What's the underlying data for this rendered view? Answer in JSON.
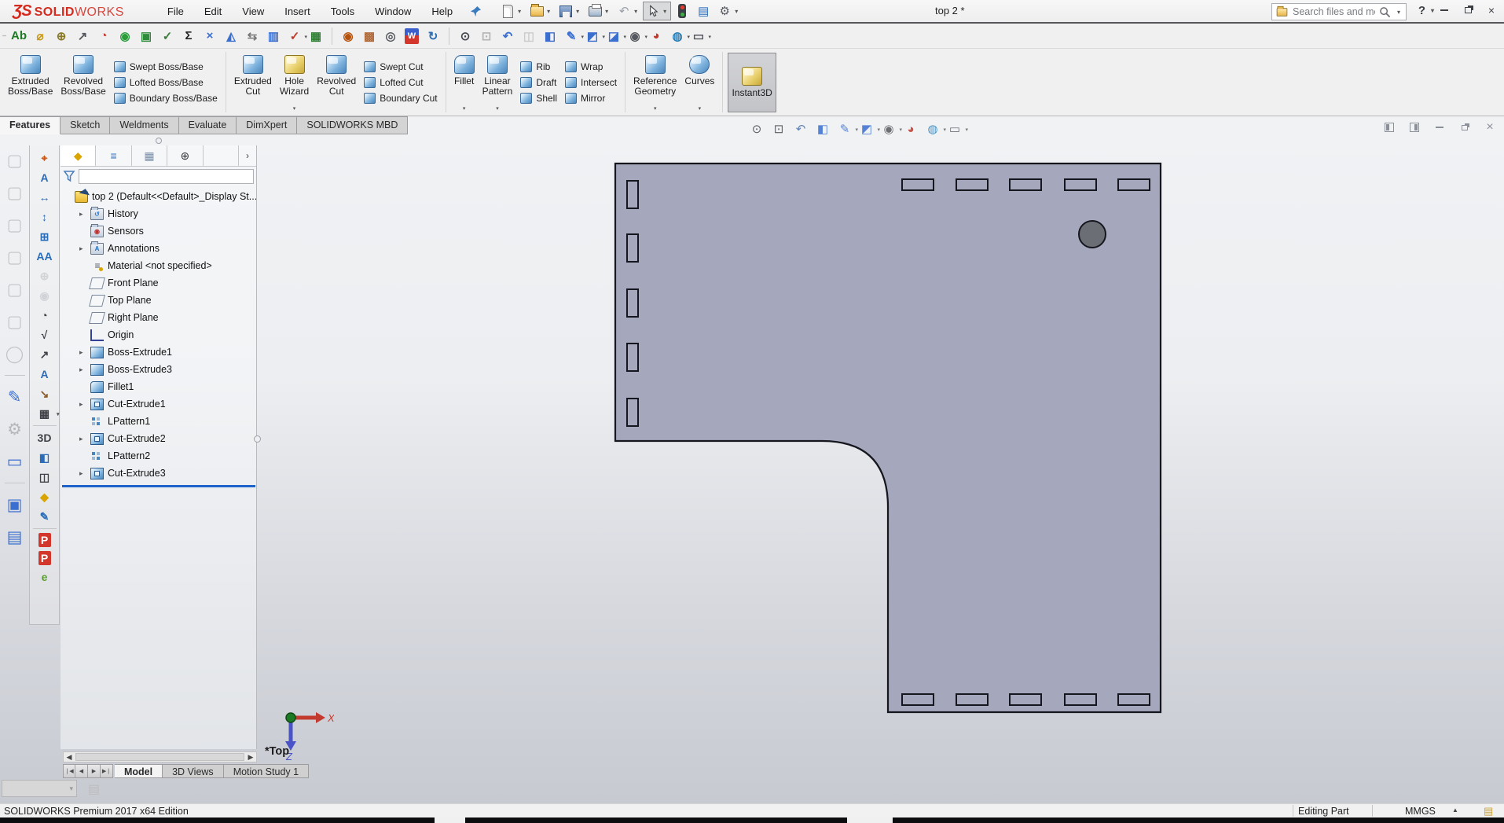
{
  "colors": {
    "brand_red": "#d42b1e",
    "part_fill": "#a5a8bc",
    "part_edge": "#16161e",
    "hole_fill": "#6c6e76",
    "rollback_blue": "#1f62c9"
  },
  "titlebar": {
    "logo_ds": "ƷS",
    "logo_solid": "SOLID",
    "logo_works": "WORKS",
    "doc_title": "top 2 *",
    "search_placeholder": "Search files and models",
    "help_label": "?",
    "menus": [
      {
        "label": "File",
        "name": "menu-file"
      },
      {
        "label": "Edit",
        "name": "menu-edit"
      },
      {
        "label": "View",
        "name": "menu-view"
      },
      {
        "label": "Insert",
        "name": "menu-insert"
      },
      {
        "label": "Tools",
        "name": "menu-tools"
      },
      {
        "label": "Window",
        "name": "menu-window"
      },
      {
        "label": "Help",
        "name": "menu-help"
      }
    ],
    "quick_tools": [
      {
        "name": "new-document-button",
        "cls": "i-doc",
        "dropdown": true
      },
      {
        "name": "open-document-button",
        "cls": "i-folder",
        "dropdown": true
      },
      {
        "name": "save-button",
        "cls": "i-save",
        "dropdown": true
      },
      {
        "name": "print-button",
        "cls": "i-print",
        "dropdown": true
      },
      {
        "name": "undo-button",
        "glyph": "↶",
        "color": "#9aa0a8",
        "dropdown": true,
        "disabled": true
      },
      {
        "name": "select-tool-button",
        "cls": "cursor",
        "dropdown": true,
        "active": true
      },
      {
        "name": "interference-check-button",
        "cls": "i-lights"
      },
      {
        "name": "options-list-button",
        "glyph": "▤",
        "color": "#2b6cb8"
      },
      {
        "name": "options-gear-button",
        "glyph": "⚙",
        "color": "#55585e",
        "dropdown": true
      }
    ]
  },
  "toolbar2": {
    "items": [
      {
        "name": "spell-checker-icon",
        "glyph": "Ab",
        "color": "#1d7a24"
      },
      {
        "name": "measure-icon",
        "glyph": "⌀",
        "color": "#c89a1a"
      },
      {
        "name": "mass-properties-icon",
        "glyph": "⊕",
        "color": "#8a7a2a"
      },
      {
        "name": "statistics-icon",
        "glyph": "↗",
        "color": "#55585e"
      },
      {
        "name": "performance-evaluation-icon",
        "glyph": "◔",
        "color": "#c0392b"
      },
      {
        "name": "assembly-visualization-icon",
        "glyph": "◉",
        "color": "#2a9d3a"
      },
      {
        "name": "check-active-document-icon",
        "glyph": "▣",
        "color": "#2e8b3a"
      },
      {
        "name": "design-checker-icon",
        "glyph": "✓",
        "color": "#3a7d3a"
      },
      {
        "name": "equations-icon",
        "glyph": "Σ",
        "color": "#222"
      },
      {
        "name": "deviation-analysis-icon",
        "glyph": "×",
        "color": "#3a6fd0"
      },
      {
        "name": "draft-analysis-icon",
        "glyph": "◭",
        "color": "#3a6fd0"
      },
      {
        "name": "symmetry-check-icon",
        "glyph": "⇆",
        "color": "#777"
      },
      {
        "name": "import-diagnostics-icon",
        "glyph": "▥",
        "color": "#3a6fd0"
      },
      {
        "name": "parting-line-analysis-icon",
        "glyph": "✓",
        "color": "#c0392b",
        "dropdown": true
      },
      {
        "name": "design-table-icon",
        "glyph": "▦",
        "color": "#2e7d32"
      },
      {
        "sep": true,
        "interactable": "false"
      },
      {
        "name": "appearance-filter-icon",
        "glyph": "◉",
        "color": "#b5520e"
      },
      {
        "name": "appearances-icon",
        "glyph": "▩",
        "color": "#b06a3a"
      },
      {
        "name": "verification-icon",
        "glyph": "◎",
        "color": "#55585e"
      },
      {
        "name": "design-binder-icon",
        "glyph": "W",
        "cls": "w-doc",
        "color": "#fff"
      },
      {
        "name": "reload-icon",
        "glyph": "↻",
        "color": "#2a6db5"
      },
      {
        "sep": true,
        "interactable": "false"
      },
      {
        "name": "zoom-to-fit-icon",
        "glyph": "⊙",
        "color": "#44474d"
      },
      {
        "name": "zoom-to-area-icon",
        "glyph": "⊡",
        "color": "#44474d",
        "disabled": true
      },
      {
        "name": "previous-view-icon",
        "glyph": "↶",
        "color": "#3a6fd0"
      },
      {
        "name": "pan-icon",
        "glyph": "◫",
        "color": "#888",
        "disabled": true
      },
      {
        "name": "section-view-icon",
        "glyph": "◧",
        "color": "#3a6fd0"
      },
      {
        "name": "3d-drawing-view-icon",
        "glyph": "✎",
        "color": "#3a6fd0",
        "dropdown": true
      },
      {
        "name": "view-orientation-icon",
        "glyph": "◩",
        "color": "#3a6fd0",
        "dropdown": true
      },
      {
        "name": "display-style-icon",
        "glyph": "◪",
        "color": "#3a6fd0",
        "dropdown": true
      },
      {
        "name": "hide-show-items-icon",
        "glyph": "◉",
        "color": "#55585e",
        "dropdown": true
      },
      {
        "name": "edit-appearance-icon",
        "glyph": "◕",
        "color": "#c0392b"
      },
      {
        "name": "apply-scene-icon",
        "glyph": "◍",
        "color": "#2980b9",
        "dropdown": true
      },
      {
        "name": "view-settings-icon",
        "glyph": "▭",
        "color": "#55585e",
        "dropdown": true
      }
    ]
  },
  "ribbon": {
    "extruded_boss": [
      "Extruded",
      "Boss/Base"
    ],
    "revolved_boss": [
      "Revolved",
      "Boss/Base"
    ],
    "swept_boss": "Swept Boss/Base",
    "lofted_boss": "Lofted Boss/Base",
    "boundary_boss": "Boundary Boss/Base",
    "extruded_cut": [
      "Extruded",
      "Cut"
    ],
    "hole_wizard": [
      "Hole",
      "Wizard"
    ],
    "revolved_cut": [
      "Revolved",
      "Cut"
    ],
    "swept_cut": "Swept Cut",
    "lofted_cut": "Lofted Cut",
    "boundary_cut": "Boundary Cut",
    "fillet": "Fillet",
    "linear_pattern": [
      "Linear",
      "Pattern"
    ],
    "rib": "Rib",
    "draft": "Draft",
    "shell": "Shell",
    "wrap": "Wrap",
    "intersect": "Intersect",
    "mirror": "Mirror",
    "reference_geometry": [
      "Reference",
      "Geometry"
    ],
    "curves": "Curves",
    "instant3d": "Instant3D"
  },
  "cm_tabs": [
    {
      "label": "Features",
      "name": "tab-features",
      "active": true
    },
    {
      "label": "Sketch",
      "name": "tab-sketch"
    },
    {
      "label": "Weldments",
      "name": "tab-weldments"
    },
    {
      "label": "Evaluate",
      "name": "tab-evaluate"
    },
    {
      "label": "DimXpert",
      "name": "tab-dimxpert"
    },
    {
      "label": "SOLIDWORKS MBD",
      "name": "tab-solidworks-mbd"
    }
  ],
  "headsup": {
    "items": [
      {
        "name": "zoom-to-fit-icon",
        "glyph": "⊙",
        "color": "#3f4248"
      },
      {
        "name": "zoom-to-area-icon",
        "glyph": "⊡",
        "color": "#3f4248"
      },
      {
        "name": "previous-view-icon",
        "glyph": "↶",
        "color": "#4a6fa5"
      },
      {
        "name": "section-view-icon",
        "glyph": "◧",
        "color": "#3a6fd0"
      },
      {
        "name": "3d-drawing-view-icon",
        "glyph": "✎",
        "color": "#3a6fd0",
        "dropdown": true
      },
      {
        "name": "view-orientation-icon",
        "glyph": "◩",
        "color": "#3a6fd0",
        "dropdown": true
      },
      {
        "name": "hide-show-items-icon",
        "glyph": "◉",
        "color": "#55585e",
        "dropdown": true
      },
      {
        "name": "edit-appearance-icon",
        "glyph": "◕",
        "color": "#c0392b"
      },
      {
        "name": "apply-scene-icon",
        "glyph": "◍",
        "color": "#2980b9",
        "dropdown": true
      },
      {
        "name": "view-settings-icon",
        "glyph": "▭",
        "color": "#55585e",
        "dropdown": true
      }
    ]
  },
  "left_outer": {
    "items": [
      {
        "name": "view-cube-ghost-icon",
        "glyph": "▢",
        "color": "#c3c5c9",
        "disabled": true
      },
      {
        "name": "view-cube-ghost-icon",
        "glyph": "▢",
        "color": "#c3c5c9",
        "disabled": true
      },
      {
        "name": "view-cube-ghost-icon",
        "glyph": "▢",
        "color": "#c3c5c9",
        "disabled": true
      },
      {
        "name": "view-cube-ghost-icon",
        "glyph": "▢",
        "color": "#c3c5c9",
        "disabled": true
      },
      {
        "name": "view-cube-ghost-icon",
        "glyph": "▢",
        "color": "#c3c5c9",
        "disabled": true
      },
      {
        "name": "view-cube-ghost-icon",
        "glyph": "▢",
        "color": "#c3c5c9",
        "disabled": true
      },
      {
        "name": "view-sphere-ghost-icon",
        "glyph": "◯",
        "color": "#c3c5c9",
        "disabled": true
      },
      {
        "sep": true,
        "interactable": "false"
      },
      {
        "name": "new-sketch-icon",
        "glyph": "✎",
        "color": "#3a6fd0"
      },
      {
        "name": "edit-feature-icon",
        "glyph": "⚙",
        "color": "#b5b7bb",
        "disabled": true
      },
      {
        "name": "screen-pane-icon",
        "glyph": "▭",
        "color": "#3a6fd0"
      },
      {
        "sep": true,
        "interactable": "false"
      },
      {
        "name": "display-pane-icon",
        "glyph": "▣",
        "color": "#3a6fd0"
      },
      {
        "name": "display-pane-alt-icon",
        "glyph": "▤",
        "color": "#3a6fd0"
      }
    ]
  },
  "left_inner": {
    "items": [
      {
        "name": "auto-dimension-icon",
        "glyph": "⌖",
        "color": "#c2571a"
      },
      {
        "name": "annotation-view-icon",
        "glyph": "A",
        "color": "#2b6cb8"
      },
      {
        "name": "size-dimension-icon",
        "glyph": "↔",
        "color": "#2b6cb8"
      },
      {
        "name": "location-dimension-icon",
        "glyph": "↕",
        "color": "#2b6cb8"
      },
      {
        "name": "geometric-tolerance-icon",
        "glyph": "⊞",
        "color": "#2b6cb8"
      },
      {
        "name": "dual-dimension-icon",
        "glyph": "AA",
        "color": "#2b6cb8"
      },
      {
        "name": "datum-target-icon",
        "glyph": "⊕",
        "color": "#9aa0a8",
        "disabled": true
      },
      {
        "name": "show-annotations-icon",
        "glyph": "◉",
        "color": "#9aa0a8",
        "disabled": true
      },
      {
        "name": "detail-view-icon",
        "glyph": "◔",
        "color": "#3f4248"
      },
      {
        "name": "surface-finish-icon",
        "glyph": "√",
        "color": "#3f4248"
      },
      {
        "name": "weld-symbol-icon",
        "glyph": "↗",
        "color": "#3f4248"
      },
      {
        "name": "note-icon",
        "glyph": "A",
        "color": "#2b6cb8"
      },
      {
        "name": "measure-arrow-icon",
        "glyph": "↘",
        "color": "#8a5a2a"
      },
      {
        "name": "general-table-icon",
        "glyph": "▦",
        "color": "#3f4248",
        "dropdown": true
      },
      {
        "sep": true,
        "interactable": "false"
      },
      {
        "name": "3d-view-capture-icon",
        "glyph": "3D",
        "color": "#3f4248"
      },
      {
        "name": "section-view-icon",
        "glyph": "◧",
        "color": "#2b6cb8"
      },
      {
        "name": "model-break-view-icon",
        "glyph": "◫",
        "color": "#3f4248"
      },
      {
        "name": "part-note-icon",
        "glyph": "◆",
        "color": "#d9a400"
      },
      {
        "name": "dynamic-annotation-icon",
        "glyph": "✎",
        "color": "#2b6cb8"
      },
      {
        "sep": true,
        "interactable": "false"
      },
      {
        "name": "3d-pdf-edit-icon",
        "glyph": "P",
        "cls": "pdf",
        "color": "#fff"
      },
      {
        "name": "publish-3d-pdf-icon",
        "glyph": "P",
        "cls": "pdf",
        "color": "#fff"
      },
      {
        "name": "edrawings-icon",
        "glyph": "e",
        "color": "#5a9e2f"
      }
    ]
  },
  "feature_tree": {
    "tabs": [
      {
        "name": "featuremanager-tab",
        "glyph": "◆",
        "color": "#d9a400",
        "active": true
      },
      {
        "name": "propertymanager-tab",
        "glyph": "≡",
        "color": "#2f6fbd"
      },
      {
        "name": "configurationmanager-tab",
        "glyph": "▦",
        "color": "#7b8fa8"
      },
      {
        "name": "dimxpertmanager-tab",
        "glyph": "⊕",
        "color": "#33363c"
      },
      {
        "name": "displaymanager-tab",
        "cls": "ball"
      },
      {
        "name": "panel-tabs-more",
        "glyph": "›",
        "color": "#444",
        "cls": "more"
      }
    ],
    "items": [
      {
        "label": "top 2  (Default<<Default>_Display St...",
        "icon": "ti-top",
        "root": true,
        "name": "tree-item-top2"
      },
      {
        "label": "History",
        "icon": "ti-folder ti-history",
        "inner": "↺",
        "arrow": true,
        "name": "tree-item-history"
      },
      {
        "label": "Sensors",
        "icon": "ti-folder ti-sensors",
        "inner": "◉",
        "name": "tree-item-sensors"
      },
      {
        "label": "Annotations",
        "icon": "ti-folder ti-annot",
        "inner": "A",
        "arrow": true,
        "name": "tree-item-annotations"
      },
      {
        "label": "Material <not specified>",
        "icon": "ti-material",
        "inner": "≡",
        "name": "tree-item-material"
      },
      {
        "label": "Front Plane",
        "icon": "ti-plane",
        "name": "tree-item-front-plane"
      },
      {
        "label": "Top Plane",
        "icon": "ti-plane",
        "name": "tree-item-top-plane"
      },
      {
        "label": "Right Plane",
        "icon": "ti-plane",
        "name": "tree-item-right-plane"
      },
      {
        "label": "Origin",
        "icon": "ti-origin",
        "name": "tree-item-origin"
      },
      {
        "label": "Boss-Extrude1",
        "icon": "ti-boss",
        "arrow": true,
        "name": "tree-item-boss-extrude1"
      },
      {
        "label": "Boss-Extrude3",
        "icon": "ti-boss",
        "arrow": true,
        "name": "tree-item-boss-extrude3"
      },
      {
        "label": "Fillet1",
        "icon": "ti-fillet",
        "name": "tree-item-fillet1"
      },
      {
        "label": "Cut-Extrude1",
        "icon": "ti-cut",
        "arrow": true,
        "name": "tree-item-cut-extrude1"
      },
      {
        "label": "LPattern1",
        "icon": "ti-lpat",
        "name": "tree-item-lpattern1"
      },
      {
        "label": "Cut-Extrude2",
        "icon": "ti-cut",
        "arrow": true,
        "name": "tree-item-cut-extrude2"
      },
      {
        "label": "LPattern2",
        "icon": "ti-lpat",
        "name": "tree-item-lpattern2"
      },
      {
        "label": "Cut-Extrude3",
        "icon": "ti-cut",
        "arrow": true,
        "name": "tree-item-cut-extrude3"
      }
    ]
  },
  "viewport": {
    "view_label": "*Top",
    "axis_x": "X",
    "axis_z": "Z"
  },
  "model_tabs": [
    {
      "label": "Model",
      "name": "tab-model",
      "active": true
    },
    {
      "label": "3D Views",
      "name": "tab-3d-views"
    },
    {
      "label": "Motion Study 1",
      "name": "tab-motion-study-1"
    }
  ],
  "statusbar": {
    "edition": "SOLIDWORKS Premium 2017 x64 Edition",
    "mode": "Editing Part",
    "units": "MMGS"
  }
}
